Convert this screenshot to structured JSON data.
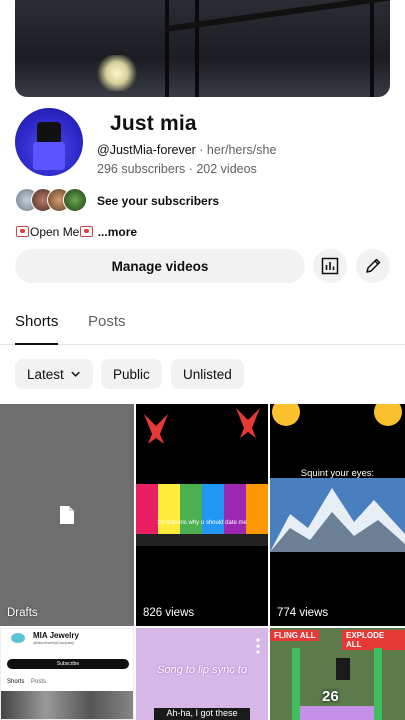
{
  "channel": {
    "name": "Just mia",
    "handle": "@JustMia-forever",
    "pronouns": " · her/hers/she",
    "stats": "296 subscribers · 202 videos",
    "see_subscribers": "See your subscribers",
    "bio_text": "Open Me",
    "bio_more": "...more"
  },
  "actions": {
    "manage_videos": "Manage videos",
    "analytics_icon": "analytics-icon",
    "edit_icon": "pencil-icon"
  },
  "tabs": [
    {
      "label": "Shorts",
      "active": true
    },
    {
      "label": "Posts",
      "active": false
    }
  ],
  "filters": [
    {
      "label": "Latest"
    },
    {
      "label": "Public"
    },
    {
      "label": "Unlisted"
    }
  ],
  "grid": {
    "drafts_label": "Drafts",
    "items": [
      {
        "views": "826 views"
      },
      {
        "views": "774 views"
      }
    ],
    "bottom": {
      "jewelry_title": "MIA Jewelry",
      "jewelry_handle": "@MiaJewelryCompany",
      "jewelry_subscribe": "Subscribe",
      "jewelry_tabs": [
        "Shorts",
        "Posts"
      ],
      "song_text": "Song  to lip sync to",
      "song_caption": "Ah-ha, I got these",
      "fling_label": "FLING ALL",
      "explode_label": "EXPLODE ALL",
      "game_number": "26",
      "mountain_caption": "Squint your eyes:",
      "reasons_caption": "10 reasons why u should date me"
    }
  },
  "colors": {
    "accent": "#0f0f0f",
    "chip_bg": "#f2f2f2",
    "muted": "#606060"
  }
}
